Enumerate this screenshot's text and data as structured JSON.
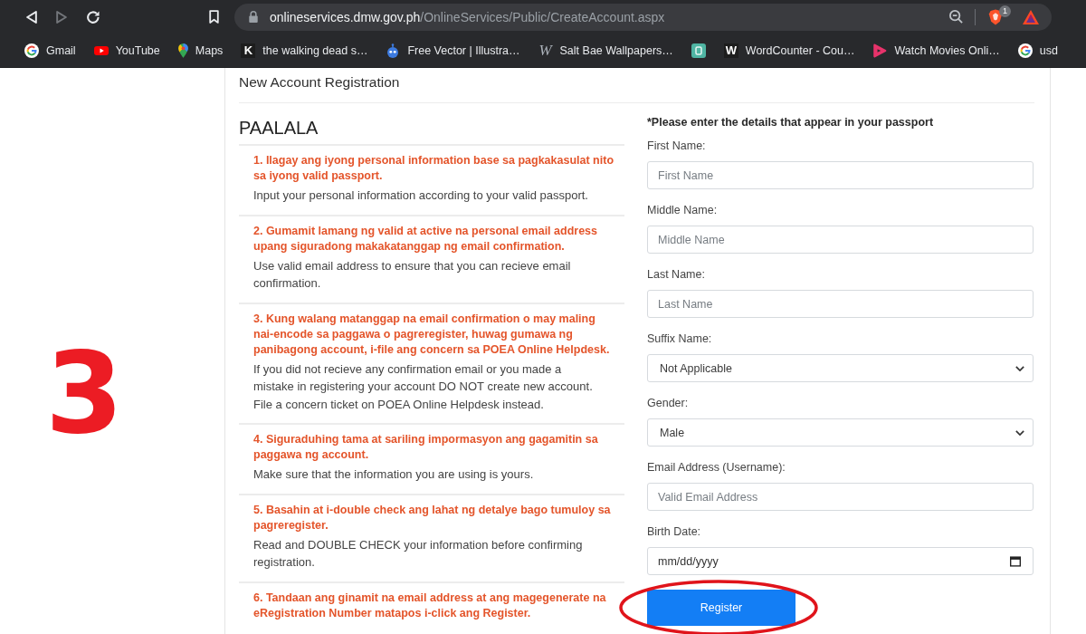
{
  "browser": {
    "forward_button": {
      "disabled": true
    },
    "address": {
      "domain": "onlineservices.dmw.gov.ph",
      "path": "/OnlineServices/Public/CreateAccount.aspx"
    },
    "extension_badge": "1",
    "bookmarks": [
      {
        "kind": "g",
        "label": "Gmail"
      },
      {
        "kind": "play",
        "label": "YouTube"
      },
      {
        "kind": "pin",
        "label": "Maps"
      },
      {
        "kind": "letter",
        "glyph": "K",
        "label": "the walking dead s…"
      },
      {
        "kind": "robot",
        "label": "Free Vector | Illustra…"
      },
      {
        "kind": "script",
        "glyph": "W",
        "label": "Salt Bae Wallpapers…"
      },
      {
        "kind": "tile"
      },
      {
        "kind": "letter",
        "glyph": "W",
        "label": "WordCounter - Cou…"
      },
      {
        "kind": "triangle",
        "label": "Watch Movies Onli…"
      },
      {
        "kind": "g",
        "label": "usd"
      }
    ]
  },
  "annotation_number": "3",
  "card": {
    "title": "New Account Registration",
    "notice": {
      "heading": "PAALALA",
      "items": [
        {
          "tagalog": "1. Ilagay ang iyong personal information base sa pagkakasulat nito sa iyong valid passport.",
          "english": "Input your personal information according to your valid passport."
        },
        {
          "tagalog": "2. Gumamit lamang ng valid at active na personal email address upang siguradong makakatanggap ng email confirmation.",
          "english": "Use valid email address to ensure that you can recieve email confirmation."
        },
        {
          "tagalog": "3. Kung walang matanggap na email confirmation o may maling nai-encode sa paggawa o pagreregister, huwag gumawa ng panibagong account, i-file ang concern sa POEA Online Helpdesk.",
          "english": "If you did not recieve any confirmation email or you made a mistake in registering your account DO NOT create new account. File a concern ticket on POEA Online Helpdesk instead."
        },
        {
          "tagalog": "4. Siguraduhing tama at sariling impormasyon ang gagamitin sa paggawa ng account.",
          "english": "Make sure that the information you are using is yours."
        },
        {
          "tagalog": "5. Basahin at i-double check ang lahat ng detalye bago tumuloy sa pagreregister.",
          "english": "Read and DOUBLE CHECK your information before confirming registration."
        },
        {
          "tagalog": "6. Tandaan ang ginamit na email address at ang magegenerate na eRegistration Number matapos i-click ang Register."
        }
      ]
    },
    "form": {
      "instruction": "*Please enter the details that appear in your passport",
      "fields": [
        {
          "kind": "text",
          "label": "First Name:",
          "placeholder": "First Name"
        },
        {
          "kind": "text",
          "label": "Middle Name:",
          "placeholder": "Middle Name"
        },
        {
          "kind": "text",
          "label": "Last Name:",
          "placeholder": "Last Name"
        },
        {
          "kind": "select",
          "label": "Suffix Name:",
          "value": "Not Applicable"
        },
        {
          "kind": "select",
          "label": "Gender:",
          "value": "Male"
        },
        {
          "kind": "text",
          "label": "Email Address (Username):",
          "placeholder": "Valid Email Address"
        },
        {
          "kind": "date",
          "label": "Birth Date:",
          "placeholder": "mm/dd/yyyy"
        }
      ],
      "submit": "Register"
    }
  }
}
